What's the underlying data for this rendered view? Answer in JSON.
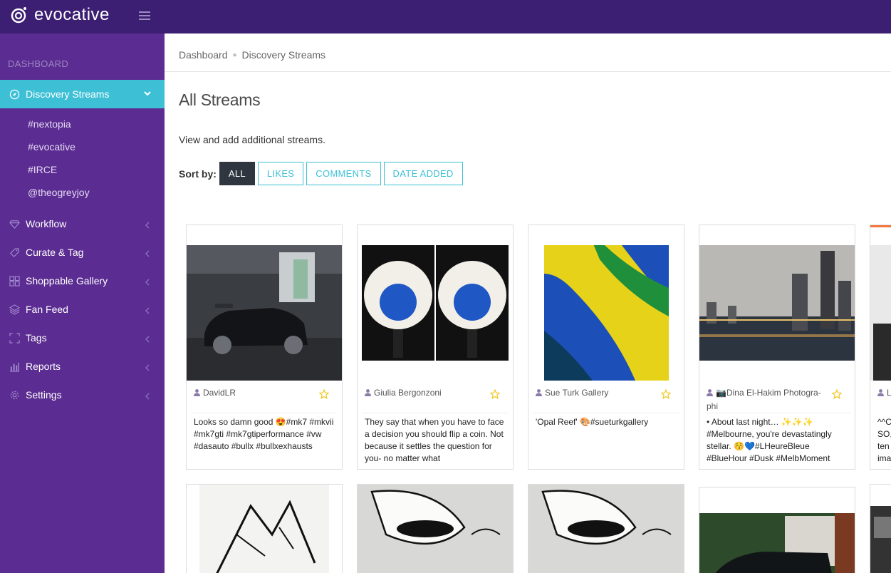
{
  "app": {
    "name": "evocative"
  },
  "sidebar": {
    "section_label": "DASHBOARD",
    "active": {
      "label": "Discovery Streams",
      "icon": "compass-icon"
    },
    "sub_items": [
      "#nextopia",
      "#evocative",
      "#IRCE",
      "@theogreyjoy"
    ],
    "items": [
      {
        "label": "Workflow",
        "icon": "diamond-icon"
      },
      {
        "label": "Curate & Tag",
        "icon": "tag-icon"
      },
      {
        "label": "Shoppable Gallery",
        "icon": "grid-icon"
      },
      {
        "label": "Fan Feed",
        "icon": "layers-icon"
      },
      {
        "label": "Tags",
        "icon": "corners-icon"
      },
      {
        "label": "Reports",
        "icon": "bar-chart-icon"
      },
      {
        "label": "Settings",
        "icon": "gear-icon"
      }
    ]
  },
  "breadcrumb": {
    "home": "Dashboard",
    "current": "Discovery Streams"
  },
  "page": {
    "title": "All Streams",
    "description": "View and add additional streams.",
    "sort_label": "Sort by:",
    "sort_options": [
      "ALL",
      "LIKES",
      "COMMENTS",
      "DATE ADDED"
    ]
  },
  "cards": [
    {
      "user": "DavidLR",
      "text": "Looks so damn good 😍#mk7 #mkvii #mk7gti #mk7gtiperformance #vw #dasauto #bullx #bullxexhausts"
    },
    {
      "user": "Giulia Bergonzoni",
      "text": "They say that when you have to face a decision you should flip a coin. Not because it settles the question for you- no matter what"
    },
    {
      "user": "Sue Turk Gallery",
      "text": "'Opal Reef' 🎨#sueturkgallery"
    },
    {
      "user": "📷Dina El-Hakim Photogra-phi",
      "text": "• About last night… ✨✨✨ #Melbourne, you're devastatingly stellar. 😚💙#LHeureBleue #BlueHour #Dusk #MelbMoment"
    }
  ],
  "partial_card": {
    "user": "L",
    "text": "^^C SO, ten ima"
  },
  "colors": {
    "topbar": "#3c1f72",
    "sidebar": "#5b2c91",
    "accent": "#3dc0d6",
    "star": "#f0c419"
  }
}
